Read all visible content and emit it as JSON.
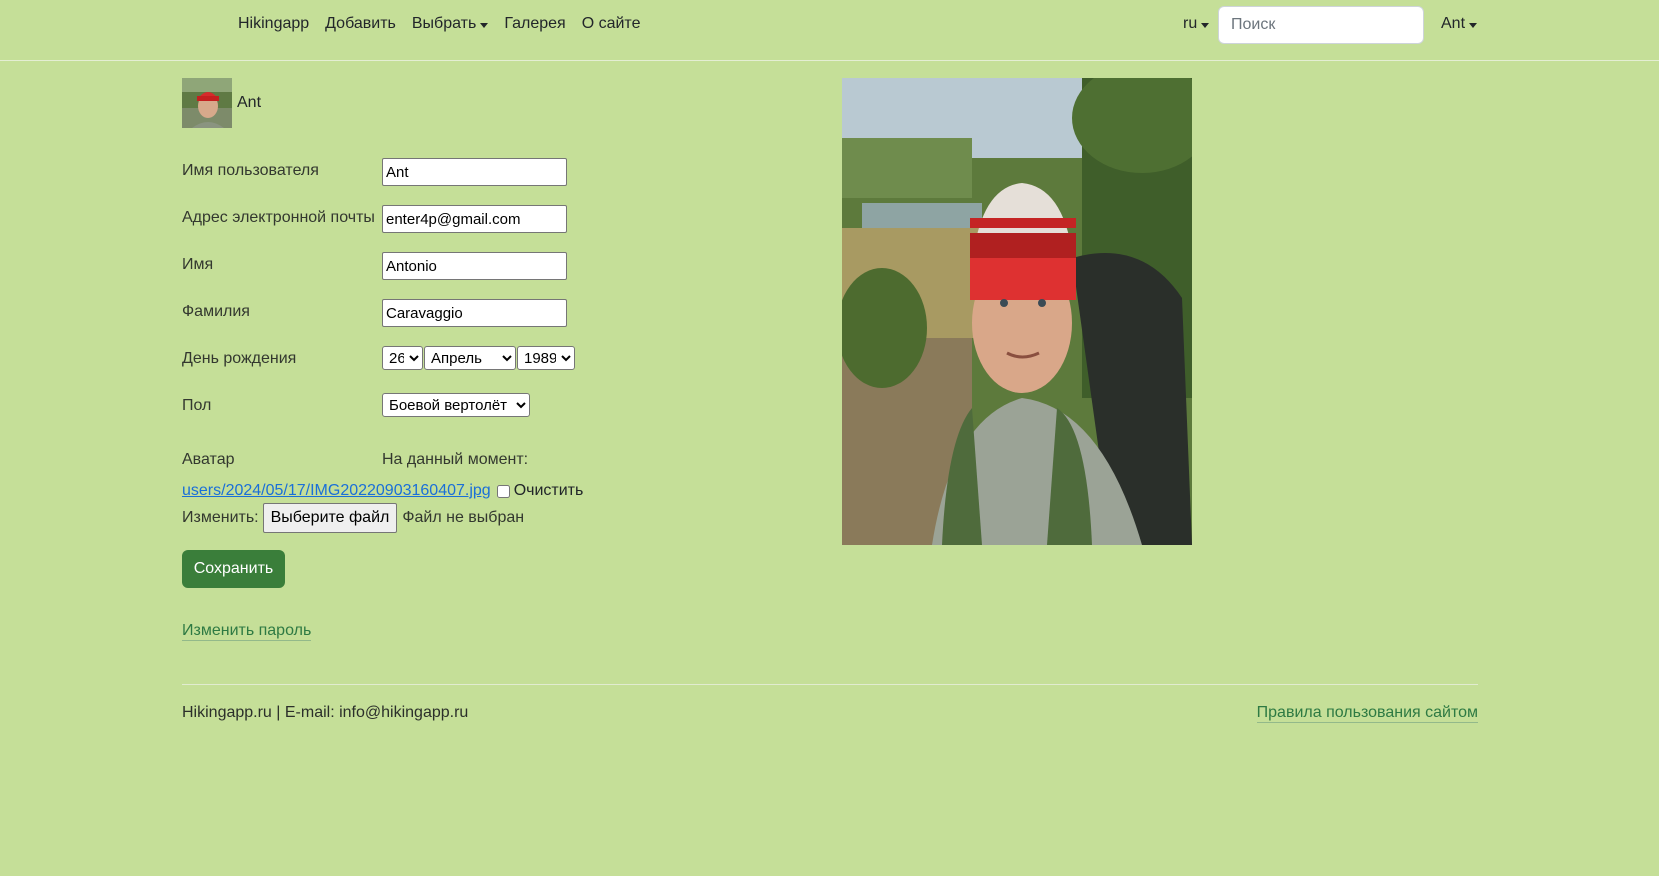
{
  "navbar": {
    "links": [
      {
        "label": "Hikingapp"
      },
      {
        "label": "Добавить"
      },
      {
        "label": "Выбрать"
      },
      {
        "label": "Галерея"
      },
      {
        "label": "О сайте"
      }
    ],
    "language": "ru",
    "search_placeholder": "Поиск",
    "user": "Ant"
  },
  "profile": {
    "name": "Ant",
    "fields": {
      "username": {
        "label": "Имя пользователя",
        "value": "Ant"
      },
      "email": {
        "label": "Адрес электронной почты",
        "value": "enter4p@gmail.com"
      },
      "first_name": {
        "label": "Имя",
        "value": "Antonio"
      },
      "last_name": {
        "label": "Фамилия",
        "value": "Caravaggio"
      },
      "birthday": {
        "label": "День рождения",
        "day": "26",
        "month": "Апрель",
        "year": "1989"
      },
      "gender": {
        "label": "Пол",
        "value": "Боевой вертолёт"
      },
      "avatar": {
        "label": "Аватар",
        "current_label": "На данный момент:",
        "file": "users/2024/05/17/IMG20220903160407.jpg",
        "clear_label": "Очистить",
        "change_label": "Изменить:",
        "choose_button": "Выберите файл",
        "no_file": "Файл не выбран"
      }
    },
    "save_button": "Сохранить",
    "change_password": "Изменить пароль"
  },
  "footer": {
    "text": "Hikingapp.ru | E-mail: info@hikingapp.ru",
    "rules_link": "Правила пользования сайтом"
  },
  "colors": {
    "background": "#c5df98",
    "save_button": "#3a7e3a",
    "link_green": "#2e7a43",
    "file_link": "#1a6fd8"
  }
}
